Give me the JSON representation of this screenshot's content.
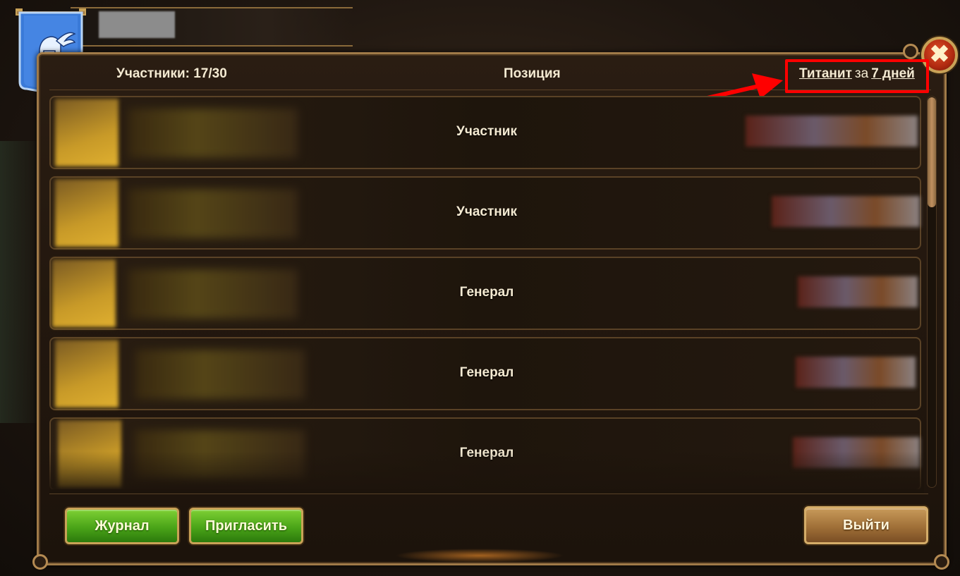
{
  "header": {
    "members_label": "Участники: 17/30",
    "position_label": "Позиция",
    "titanite_word": "Титанит",
    "titanite_mid": "за",
    "titanite_period": "7 дней"
  },
  "members": [
    {
      "role": "Участник"
    },
    {
      "role": "Участник"
    },
    {
      "role": "Генерал"
    },
    {
      "role": "Генерал"
    },
    {
      "role": "Генерал"
    }
  ],
  "buttons": {
    "journal": "Журнал",
    "invite": "Пригласить",
    "leave": "Выйти",
    "close": "✖"
  },
  "colors": {
    "highlight": "#ff0000",
    "button_green": "#4aa418",
    "button_gold": "#a07038",
    "banner_blue": "#3a7ad8",
    "close_red": "#b02a10"
  },
  "icons": {
    "banner": "winged-helmet-banner-icon",
    "close": "close-icon"
  },
  "scroll": {
    "position_fraction": 0
  }
}
